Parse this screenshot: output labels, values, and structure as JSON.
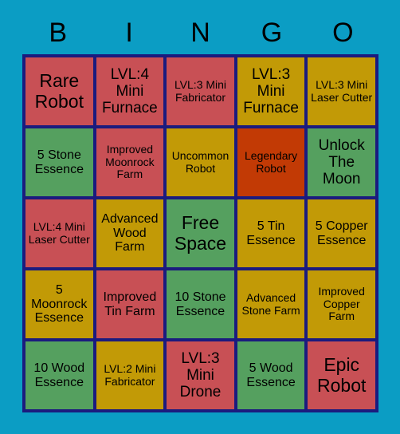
{
  "header": {
    "letters": [
      "B",
      "I",
      "N",
      "G",
      "O"
    ]
  },
  "colors": {
    "background": "#0b9dc4",
    "grid_border": "#1b1b7e",
    "red": "#c85055",
    "gold": "#c29a06",
    "green": "#55a05f",
    "orange": "#c23a05",
    "text": "#000000"
  },
  "grid": {
    "rows": 5,
    "columns": 5,
    "cells": [
      {
        "text": "Rare Robot",
        "color": "red",
        "size": "fs-xl"
      },
      {
        "text": "LVL:4 Mini Furnace",
        "color": "red",
        "size": "fs-lg"
      },
      {
        "text": "LVL:3 Mini Fabricator",
        "color": "red",
        "size": "fs-sm"
      },
      {
        "text": "LVL:3 Mini Furnace",
        "color": "gold",
        "size": "fs-lg"
      },
      {
        "text": "LVL:3 Mini Laser Cutter",
        "color": "gold",
        "size": "fs-sm"
      },
      {
        "text": "5 Stone Essence",
        "color": "green",
        "size": "fs-md"
      },
      {
        "text": "Improved Moonrock Farm",
        "color": "red",
        "size": "fs-sm"
      },
      {
        "text": "Uncommon Robot",
        "color": "gold",
        "size": "fs-sm"
      },
      {
        "text": "Legendary Robot",
        "color": "orange",
        "size": "fs-sm"
      },
      {
        "text": "Unlock The Moon",
        "color": "green",
        "size": "fs-lg"
      },
      {
        "text": "LVL:4 Mini Laser Cutter",
        "color": "red",
        "size": "fs-sm"
      },
      {
        "text": "Advanced Wood Farm",
        "color": "gold",
        "size": "fs-md"
      },
      {
        "text": "Free Space",
        "color": "green",
        "size": "fs-xl"
      },
      {
        "text": "5 Tin Essence",
        "color": "gold",
        "size": "fs-md"
      },
      {
        "text": "5 Copper Essence",
        "color": "gold",
        "size": "fs-md"
      },
      {
        "text": "5 Moonrock Essence",
        "color": "gold",
        "size": "fs-md"
      },
      {
        "text": "Improved Tin Farm",
        "color": "red",
        "size": "fs-md"
      },
      {
        "text": "10 Stone Essence",
        "color": "green",
        "size": "fs-md"
      },
      {
        "text": "Advanced Stone Farm",
        "color": "gold",
        "size": "fs-sm"
      },
      {
        "text": "Improved Copper Farm",
        "color": "gold",
        "size": "fs-sm"
      },
      {
        "text": "10 Wood Essence",
        "color": "green",
        "size": "fs-md"
      },
      {
        "text": "LVL:2 Mini Fabricator",
        "color": "gold",
        "size": "fs-sm"
      },
      {
        "text": "LVL:3 Mini Drone",
        "color": "red",
        "size": "fs-lg"
      },
      {
        "text": "5 Wood Essence",
        "color": "green",
        "size": "fs-md"
      },
      {
        "text": "Epic Robot",
        "color": "red",
        "size": "fs-xl"
      }
    ]
  }
}
